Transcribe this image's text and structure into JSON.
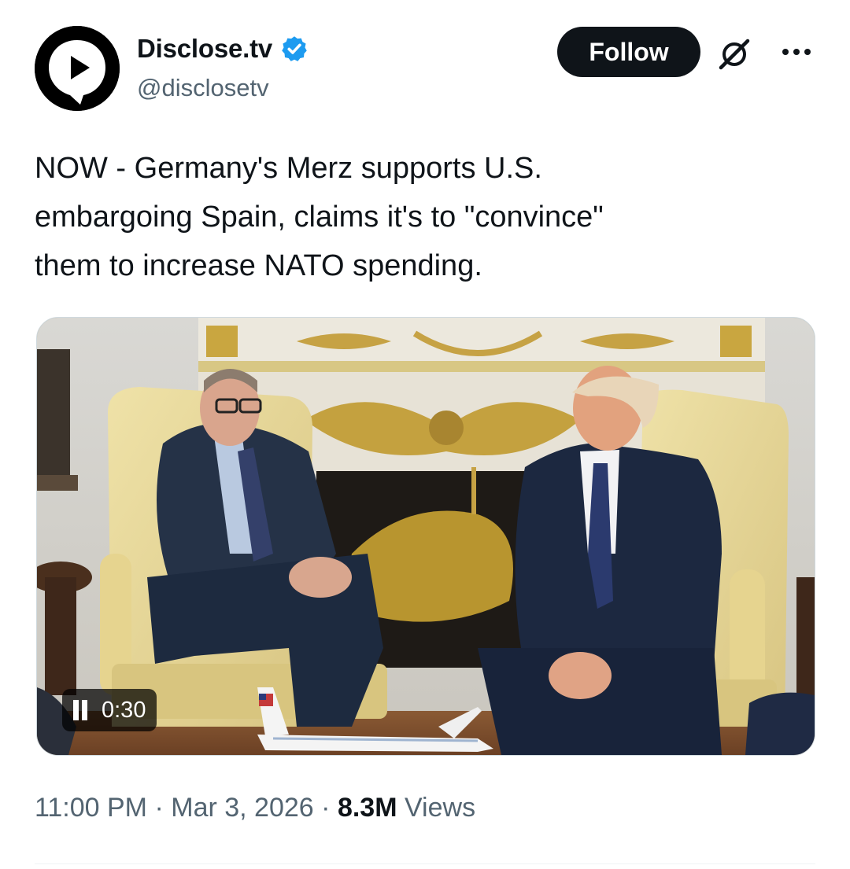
{
  "post": {
    "author": {
      "display_name": "Disclose.tv",
      "handle": "@disclosetv",
      "verified": true,
      "avatar_icon": "play-speech-bubble-logo"
    },
    "follow_label": "Follow",
    "grok_icon": "grok-slash-icon",
    "more_icon": "more-dots-icon",
    "text": "NOW - Germany's Merz supports U.S.\nembargoing Spain, claims it's to \"convince\"\nthem to increase NATO spending.",
    "media": {
      "type": "video",
      "playback_state": "playing",
      "control_icon": "pause-icon",
      "time": "0:30"
    },
    "meta": {
      "time": "11:00 PM",
      "separator": "·",
      "date": "Mar 3, 2026",
      "views_count": "8.3M",
      "views_label": "Views"
    }
  },
  "colors": {
    "text_primary": "#0f1419",
    "text_secondary": "#536471",
    "verified_blue": "#1d9bf0",
    "follow_bg": "#0f1419",
    "border": "#cfd9de"
  }
}
